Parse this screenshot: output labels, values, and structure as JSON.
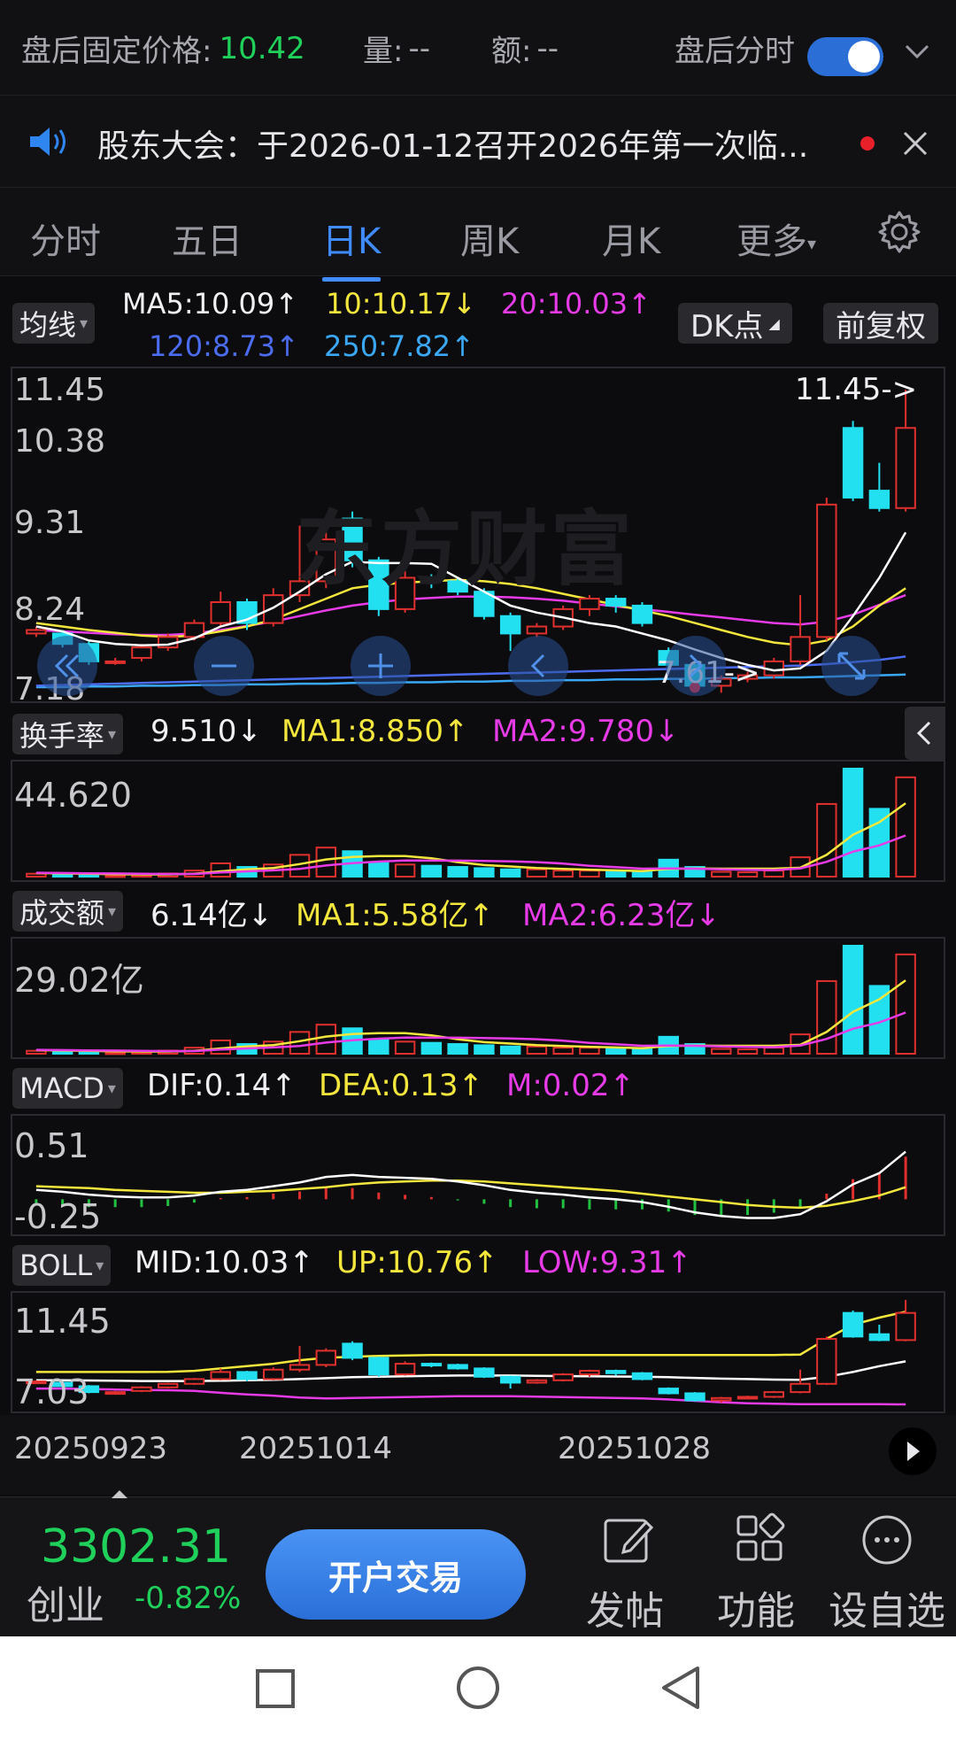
{
  "topbar": {
    "fixed_price_label": "盘后固定价格:",
    "fixed_price_value": "10.42",
    "volume_label": "量:",
    "volume_value": "--",
    "amount_label": "额:",
    "amount_value": "--",
    "after_hours_label": "盘后分时"
  },
  "notice": {
    "text": "股东大会：于2026-01-12召开2026年第一次临..."
  },
  "tabs": [
    {
      "label": "分时"
    },
    {
      "label": "五日"
    },
    {
      "label": "日K"
    },
    {
      "label": "周K"
    },
    {
      "label": "月K"
    },
    {
      "label": "更多"
    }
  ],
  "ma_header": {
    "selector": "均线",
    "ma5": "MA5:10.09↑",
    "ma10": "10:10.17↓",
    "ma20": "20:10.03↑",
    "ma120": "120:8.73↑",
    "ma250": "250:7.82↑",
    "dk_button": "DK点",
    "fq_button": "前复权"
  },
  "kline_axis": [
    "11.45",
    "10.38",
    "9.31",
    "8.24",
    "7.18"
  ],
  "kline_annotations": {
    "high": "11.45->",
    "low": "7.61->",
    "watermark": "东方财富"
  },
  "turnover": {
    "selector": "换手率",
    "value": "9.510↓",
    "ma1": "MA1:8.850↑",
    "ma2": "MA2:9.780↓",
    "axis_max": "44.620"
  },
  "amount": {
    "selector": "成交额",
    "value": "6.14亿↓",
    "ma1": "MA1:5.58亿↑",
    "ma2": "MA2:6.23亿↓",
    "axis_max": "29.02亿"
  },
  "macd": {
    "selector": "MACD",
    "dif": "DIF:0.14↑",
    "dea": "DEA:0.13↑",
    "m": "M:0.02↑",
    "axis_top": "0.51",
    "axis_bottom": "-0.25"
  },
  "boll": {
    "selector": "BOLL",
    "mid": "MID:10.03↑",
    "up": "UP:10.76↑",
    "low": "LOW:9.31↑",
    "axis_top": "11.45",
    "axis_bottom": "7.03"
  },
  "dates": [
    "20250923",
    "20251014",
    "20251028"
  ],
  "bottom": {
    "index_value": "3302.31",
    "index_name": "创业",
    "index_change": "-0.82%",
    "trade_button": "开户交易",
    "post": "发帖",
    "functions": "功能",
    "watchlist": "设自选"
  },
  "colors": {
    "rise": "#e0302e",
    "fall": "#22e0f0",
    "ma5": "#ffffff",
    "ma10": "#f3e63c",
    "ma20": "#e63be6",
    "ma120": "#4c6cf0",
    "ma250": "#3aa8f5",
    "accent": "#3f8bff",
    "down_green": "#1fd05a"
  },
  "chart_data": {
    "type": "candlestick",
    "dates": [
      "20250923",
      "20251014",
      "20251028"
    ],
    "ylim": [
      7.18,
      11.45
    ],
    "candles": [
      [
        7.95,
        8.0,
        8.05,
        7.9
      ],
      [
        7.95,
        7.8,
        8.0,
        7.75
      ],
      [
        7.8,
        7.55,
        7.85,
        7.5
      ],
      [
        7.55,
        7.55,
        7.6,
        7.5
      ],
      [
        7.6,
        7.75,
        7.8,
        7.55
      ],
      [
        7.75,
        7.9,
        7.95,
        7.7
      ],
      [
        7.9,
        8.1,
        8.15,
        7.85
      ],
      [
        8.1,
        8.4,
        8.55,
        8.05
      ],
      [
        8.4,
        8.1,
        8.45,
        8.0
      ],
      [
        8.1,
        8.5,
        8.6,
        8.05
      ],
      [
        8.5,
        8.7,
        9.5,
        8.4
      ],
      [
        8.7,
        9.3,
        9.4,
        8.6
      ],
      [
        9.6,
        9.0,
        9.7,
        8.9
      ],
      [
        9.0,
        8.3,
        9.05,
        8.2
      ],
      [
        8.3,
        8.75,
        8.85,
        8.25
      ],
      [
        8.75,
        8.7,
        8.8,
        8.6
      ],
      [
        8.7,
        8.55,
        8.75,
        8.5
      ],
      [
        8.55,
        8.2,
        8.6,
        8.15
      ],
      [
        8.2,
        7.95,
        8.25,
        7.7
      ],
      [
        7.95,
        8.05,
        8.1,
        7.9
      ],
      [
        8.05,
        8.3,
        8.35,
        8.0
      ],
      [
        8.3,
        8.45,
        8.5,
        8.2
      ],
      [
        8.45,
        8.35,
        8.5,
        8.25
      ],
      [
        8.35,
        8.1,
        8.4,
        8.05
      ],
      [
        7.7,
        7.5,
        7.75,
        7.45
      ],
      [
        7.5,
        7.2,
        7.55,
        7.15
      ],
      [
        7.2,
        7.3,
        7.35,
        7.1
      ],
      [
        7.3,
        7.35,
        7.4,
        7.25
      ],
      [
        7.35,
        7.55,
        7.6,
        7.3
      ],
      [
        7.55,
        7.9,
        8.5,
        7.5
      ],
      [
        7.9,
        9.8,
        9.9,
        7.85
      ],
      [
        10.9,
        9.9,
        11.0,
        9.85
      ],
      [
        10.0,
        9.75,
        10.4,
        9.7
      ],
      [
        9.75,
        10.9,
        11.45,
        9.7
      ]
    ],
    "ma5": [
      8.05,
      7.98,
      7.85,
      7.8,
      7.78,
      7.79,
      7.88,
      8.05,
      8.15,
      8.32,
      8.55,
      8.8,
      8.98,
      8.96,
      8.96,
      8.95,
      8.75,
      8.55,
      8.35,
      8.25,
      8.18,
      8.1,
      8.05,
      7.95,
      7.85,
      7.72,
      7.6,
      7.5,
      7.42,
      7.45,
      7.7,
      8.2,
      8.75,
      9.4
    ],
    "ma10": [
      8.1,
      8.05,
      8.0,
      7.96,
      7.92,
      7.9,
      7.92,
      7.98,
      8.05,
      8.15,
      8.3,
      8.45,
      8.6,
      8.65,
      8.68,
      8.7,
      8.72,
      8.7,
      8.66,
      8.6,
      8.52,
      8.44,
      8.36,
      8.28,
      8.2,
      8.1,
      8.0,
      7.9,
      7.82,
      7.78,
      7.85,
      8.05,
      8.35,
      8.6
    ],
    "ma20": [
      8.0,
      7.98,
      7.96,
      7.94,
      7.93,
      7.93,
      7.95,
      8.0,
      8.06,
      8.12,
      8.2,
      8.28,
      8.35,
      8.4,
      8.44,
      8.46,
      8.48,
      8.48,
      8.47,
      8.45,
      8.42,
      8.38,
      8.34,
      8.3,
      8.26,
      8.22,
      8.18,
      8.14,
      8.1,
      8.08,
      8.12,
      8.22,
      8.36,
      8.5
    ],
    "ma120": [
      7.2,
      7.21,
      7.22,
      7.23,
      7.24,
      7.25,
      7.26,
      7.27,
      7.28,
      7.29,
      7.3,
      7.31,
      7.32,
      7.33,
      7.34,
      7.35,
      7.36,
      7.37,
      7.38,
      7.39,
      7.4,
      7.41,
      7.42,
      7.43,
      7.44,
      7.45,
      7.46,
      7.47,
      7.48,
      7.49,
      7.51,
      7.54,
      7.57,
      7.62
    ],
    "ma250": [
      7.18,
      7.18,
      7.19,
      7.19,
      7.2,
      7.2,
      7.21,
      7.21,
      7.22,
      7.22,
      7.23,
      7.23,
      7.24,
      7.24,
      7.25,
      7.25,
      7.26,
      7.26,
      7.27,
      7.27,
      7.28,
      7.28,
      7.29,
      7.29,
      7.3,
      7.3,
      7.31,
      7.31,
      7.32,
      7.32,
      7.33,
      7.34,
      7.35,
      7.36
    ],
    "turnover": [
      1.2,
      1.0,
      0.9,
      0.6,
      0.8,
      1.3,
      2.5,
      5.5,
      4.0,
      5.0,
      9.0,
      12.0,
      10.5,
      6.0,
      5.0,
      4.5,
      4.0,
      3.5,
      3.0,
      3.0,
      2.5,
      2.5,
      2.0,
      1.8,
      7.0,
      4.0,
      2.0,
      1.8,
      2.5,
      8.0,
      30.0,
      44.6,
      28.0,
      41.0
    ],
    "turnover_ma1": [
      1.5,
      1.3,
      1.2,
      1.0,
      0.9,
      0.9,
      1.2,
      2.2,
      3.0,
      3.6,
      5.2,
      7.1,
      8.1,
      8.5,
      8.5,
      7.6,
      6.0,
      4.8,
      4.2,
      3.6,
      3.2,
      2.9,
      2.6,
      2.3,
      3.2,
      3.4,
      3.3,
      3.3,
      3.3,
      3.7,
      9.0,
      17.3,
      22.5,
      30.3
    ],
    "turnover_ma2": [
      1.6,
      1.5,
      1.4,
      1.3,
      1.2,
      1.1,
      1.1,
      1.7,
      2.2,
      2.6,
      3.2,
      4.6,
      5.6,
      6.2,
      6.7,
      6.6,
      6.6,
      6.5,
      6.3,
      6.0,
      5.4,
      4.5,
      3.9,
      3.3,
      3.4,
      3.3,
      3.0,
      2.8,
      2.7,
      3.4,
      6.1,
      10.3,
      12.9,
      17.0
    ],
    "macd_dif": [
      0.1,
      0.08,
      0.05,
      0.03,
      0.02,
      0.02,
      0.04,
      0.08,
      0.1,
      0.14,
      0.18,
      0.24,
      0.26,
      0.24,
      0.23,
      0.22,
      0.19,
      0.15,
      0.1,
      0.07,
      0.05,
      0.02,
      0.0,
      -0.03,
      -0.08,
      -0.14,
      -0.18,
      -0.2,
      -0.2,
      -0.16,
      -0.02,
      0.16,
      0.28,
      0.51
    ],
    "macd_dea": [
      0.14,
      0.13,
      0.12,
      0.1,
      0.09,
      0.08,
      0.07,
      0.07,
      0.08,
      0.09,
      0.11,
      0.13,
      0.16,
      0.18,
      0.19,
      0.2,
      0.2,
      0.19,
      0.17,
      0.15,
      0.13,
      0.11,
      0.09,
      0.06,
      0.03,
      0.0,
      -0.03,
      -0.06,
      -0.08,
      -0.09,
      -0.07,
      -0.02,
      0.04,
      0.13
    ],
    "macd_m": [
      -0.08,
      -0.1,
      -0.14,
      -0.14,
      -0.14,
      -0.12,
      -0.06,
      0.02,
      0.04,
      0.1,
      0.14,
      0.22,
      0.2,
      0.12,
      0.08,
      0.04,
      -0.02,
      -0.08,
      -0.14,
      -0.16,
      -0.16,
      -0.18,
      -0.18,
      -0.18,
      -0.22,
      -0.28,
      -0.3,
      -0.28,
      -0.24,
      -0.14,
      0.1,
      0.36,
      0.48,
      0.76
    ],
    "boll_mid": [
      8.05,
      8.05,
      8.04,
      8.03,
      8.02,
      8.02,
      8.02,
      8.03,
      8.05,
      8.07,
      8.1,
      8.14,
      8.18,
      8.2,
      8.22,
      8.24,
      8.25,
      8.25,
      8.25,
      8.24,
      8.23,
      8.22,
      8.21,
      8.2,
      8.18,
      8.15,
      8.12,
      8.1,
      8.08,
      8.07,
      8.2,
      8.4,
      8.65,
      8.85
    ],
    "boll_up": [
      8.4,
      8.4,
      8.4,
      8.4,
      8.4,
      8.41,
      8.45,
      8.55,
      8.65,
      8.75,
      8.9,
      9.0,
      9.05,
      9.08,
      9.1,
      9.12,
      9.12,
      9.12,
      9.12,
      9.12,
      9.12,
      9.12,
      9.12,
      9.12,
      9.12,
      9.12,
      9.12,
      9.12,
      9.12,
      9.14,
      9.8,
      10.4,
      10.7,
      10.95
    ],
    "boll_low": [
      7.7,
      7.7,
      7.68,
      7.66,
      7.64,
      7.63,
      7.6,
      7.52,
      7.45,
      7.4,
      7.32,
      7.28,
      7.3,
      7.32,
      7.34,
      7.36,
      7.38,
      7.38,
      7.38,
      7.36,
      7.34,
      7.32,
      7.3,
      7.28,
      7.24,
      7.18,
      7.12,
      7.08,
      7.06,
      7.04,
      7.04,
      7.04,
      7.04,
      7.03
    ]
  }
}
